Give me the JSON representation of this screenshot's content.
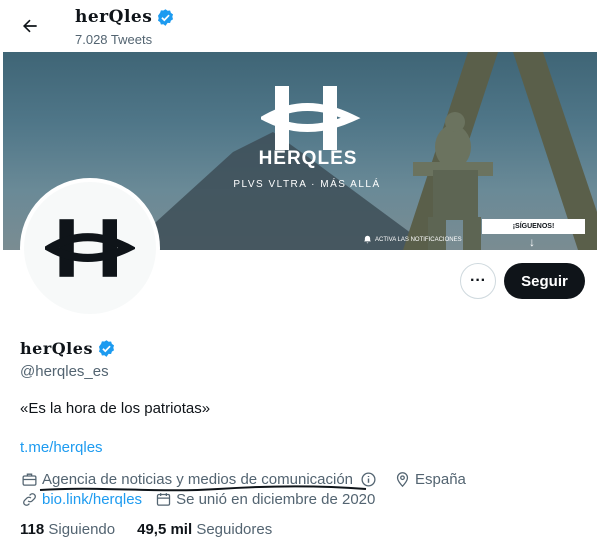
{
  "header": {
    "name": "herQles",
    "tweet_count": "7.028 Tweets"
  },
  "banner": {
    "title": "HERQLES",
    "tagline": "PLVS VLTRA · MÁS ALLÁ",
    "notif_text": "ACTIVA LAS NOTIFICACIONES",
    "follow_label": "¡SÍGUENOS!"
  },
  "actions": {
    "more_label": "···",
    "follow_label": "Seguir"
  },
  "profile": {
    "name": "herQles",
    "handle": "@herqles_es",
    "bio": "«Es la hora de los patriotas»",
    "link": "t.me/herqles",
    "category": "Agencia de noticias y medios de comunicación",
    "location": "España",
    "website": "bio.link/herqles",
    "joined": "Se unió en diciembre de 2020"
  },
  "stats": {
    "following_count": "118",
    "following_label": "Siguiendo",
    "followers_count": "49,5 mil",
    "followers_label": "Seguidores"
  },
  "colors": {
    "accent": "#1d9bf0",
    "text": "#0f1419",
    "muted": "#536471",
    "follow_button": "#0f1419"
  },
  "icons": [
    "back-arrow-icon",
    "verified-badge-icon",
    "briefcase-icon",
    "info-icon",
    "location-pin-icon",
    "link-icon",
    "calendar-icon",
    "bell-icon",
    "down-arrow-icon"
  ]
}
